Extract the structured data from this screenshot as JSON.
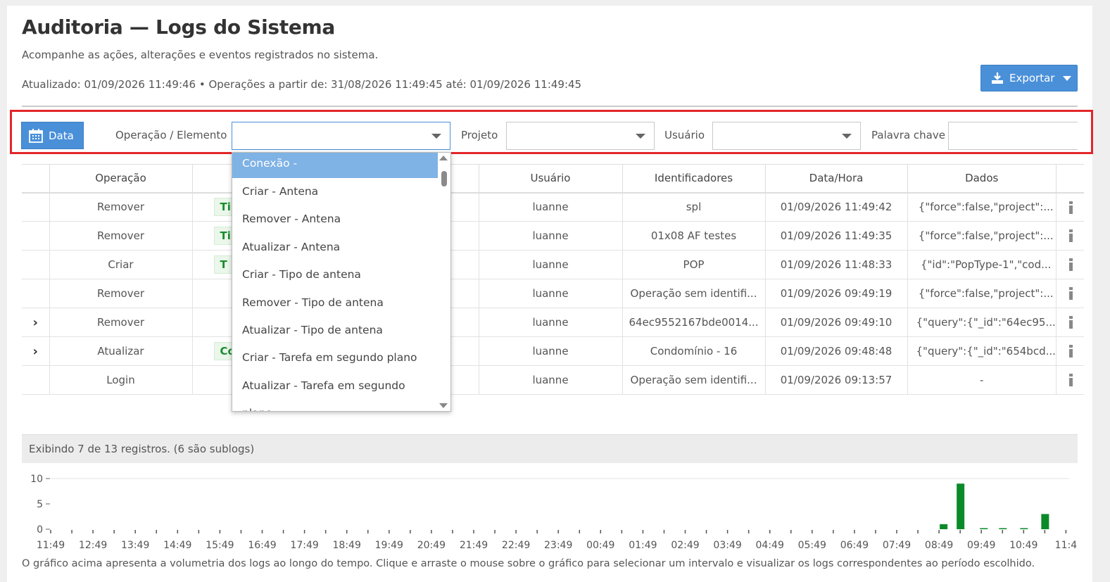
{
  "header": {
    "title": "Auditoria — Logs do Sistema",
    "subtitle": "Acompanhe as ações, alterações e eventos registrados no sistema.",
    "updated": "Atualizado: 01/09/2026 11:49:46 • Operações a partir de: 31/08/2026 11:49:45 até: 01/09/2026 11:49:45",
    "export_label": "Exportar"
  },
  "filters": {
    "date_label": "Data",
    "operation_label": "Operação / Elemento",
    "project_label": "Projeto",
    "user_label": "Usuário",
    "keyword_label": "Palavra chave"
  },
  "dropdown": {
    "items": [
      "Conexão -",
      "Criar - Antena",
      "Remover - Antena",
      "Atualizar - Antena",
      "Criar - Tipo de antena",
      "Remover - Tipo de antena",
      "Atualizar - Tipo de antena",
      "Criar - Tarefa em segundo plano",
      "Atualizar - Tarefa em segundo",
      "plano"
    ]
  },
  "table": {
    "headers": [
      "Operação",
      "Usuário",
      "Identificadores",
      "Data/Hora",
      "Dados"
    ],
    "rows": [
      {
        "chev": "",
        "op": "Remover",
        "tag": "Ti",
        "user": "luanne",
        "ident": "spl",
        "dt": "01/09/2026 11:49:42",
        "dados": "{\"force\":false,\"project\":..."
      },
      {
        "chev": "",
        "op": "Remover",
        "tag": "Ti",
        "user": "luanne",
        "ident": "01x08 AF testes",
        "dt": "01/09/2026 11:49:35",
        "dados": "{\"force\":false,\"project\":..."
      },
      {
        "chev": "",
        "op": "Criar",
        "tag": "T",
        "user": "luanne",
        "ident": "POP",
        "dt": "01/09/2026 11:48:33",
        "dados": "{\"id\":\"PopType-1\",\"cod..."
      },
      {
        "chev": "",
        "op": "Remover",
        "tag": "",
        "user": "luanne",
        "ident": "Operação sem identifi...",
        "dt": "01/09/2026 09:49:19",
        "dados": "{\"force\":false,\"project\":..."
      },
      {
        "chev": "›",
        "op": "Remover",
        "tag": "",
        "user": "luanne",
        "ident": "64ec9552167bde0014...",
        "dt": "01/09/2026 09:49:10",
        "dados": "{\"query\":{\"_id\":\"64ec95..."
      },
      {
        "chev": "›",
        "op": "Atualizar",
        "tag": "Cor",
        "user": "luanne",
        "ident": "Condomínio - 16",
        "dt": "01/09/2026 09:48:48",
        "dados": "{\"query\":{\"_id\":\"654bcd..."
      },
      {
        "chev": "",
        "op": "Login",
        "tag": "",
        "user": "luanne",
        "ident": "Operação sem identifi...",
        "dt": "01/09/2026 09:13:57",
        "dados": "-"
      }
    ]
  },
  "summary": "Exibindo 7 de 13 registros. (6 são sublogs)",
  "chart_caption": "O gráfico acima apresenta a volumetria dos logs ao longo do tempo. Clique e arraste o mouse sobre o gráfico para selecionar um intervalo e visualizar os logs correspondentes ao período escolhido.",
  "chart_data": {
    "type": "bar",
    "title": "",
    "xlabel": "",
    "ylabel": "",
    "ylim": [
      0,
      10
    ],
    "yticks": [
      "0",
      "5",
      "10"
    ],
    "x_tick_labels": [
      "11:49",
      "12:49",
      "13:49",
      "14:49",
      "15:49",
      "16:49",
      "17:49",
      "18:49",
      "19:49",
      "20:49",
      "21:49",
      "22:49",
      "23:49",
      "00:49",
      "01:49",
      "02:49",
      "03:49",
      "04:49",
      "05:49",
      "06:49",
      "07:49",
      "08:49",
      "09:49",
      "10:49",
      "11:4"
    ],
    "color": "#0b8a2a",
    "bars": [
      {
        "x": "08:49",
        "offset": 0.1,
        "value": 1
      },
      {
        "x": "08:49",
        "offset": 0.5,
        "value": 9
      },
      {
        "x": "09:49",
        "offset": 0.05,
        "value": 0.1
      },
      {
        "x": "09:49",
        "offset": 0.5,
        "value": 0.1
      },
      {
        "x": "09:49",
        "offset": 1.0,
        "value": 0.1
      },
      {
        "x": "10:49",
        "offset": 0.5,
        "value": 3
      }
    ]
  }
}
